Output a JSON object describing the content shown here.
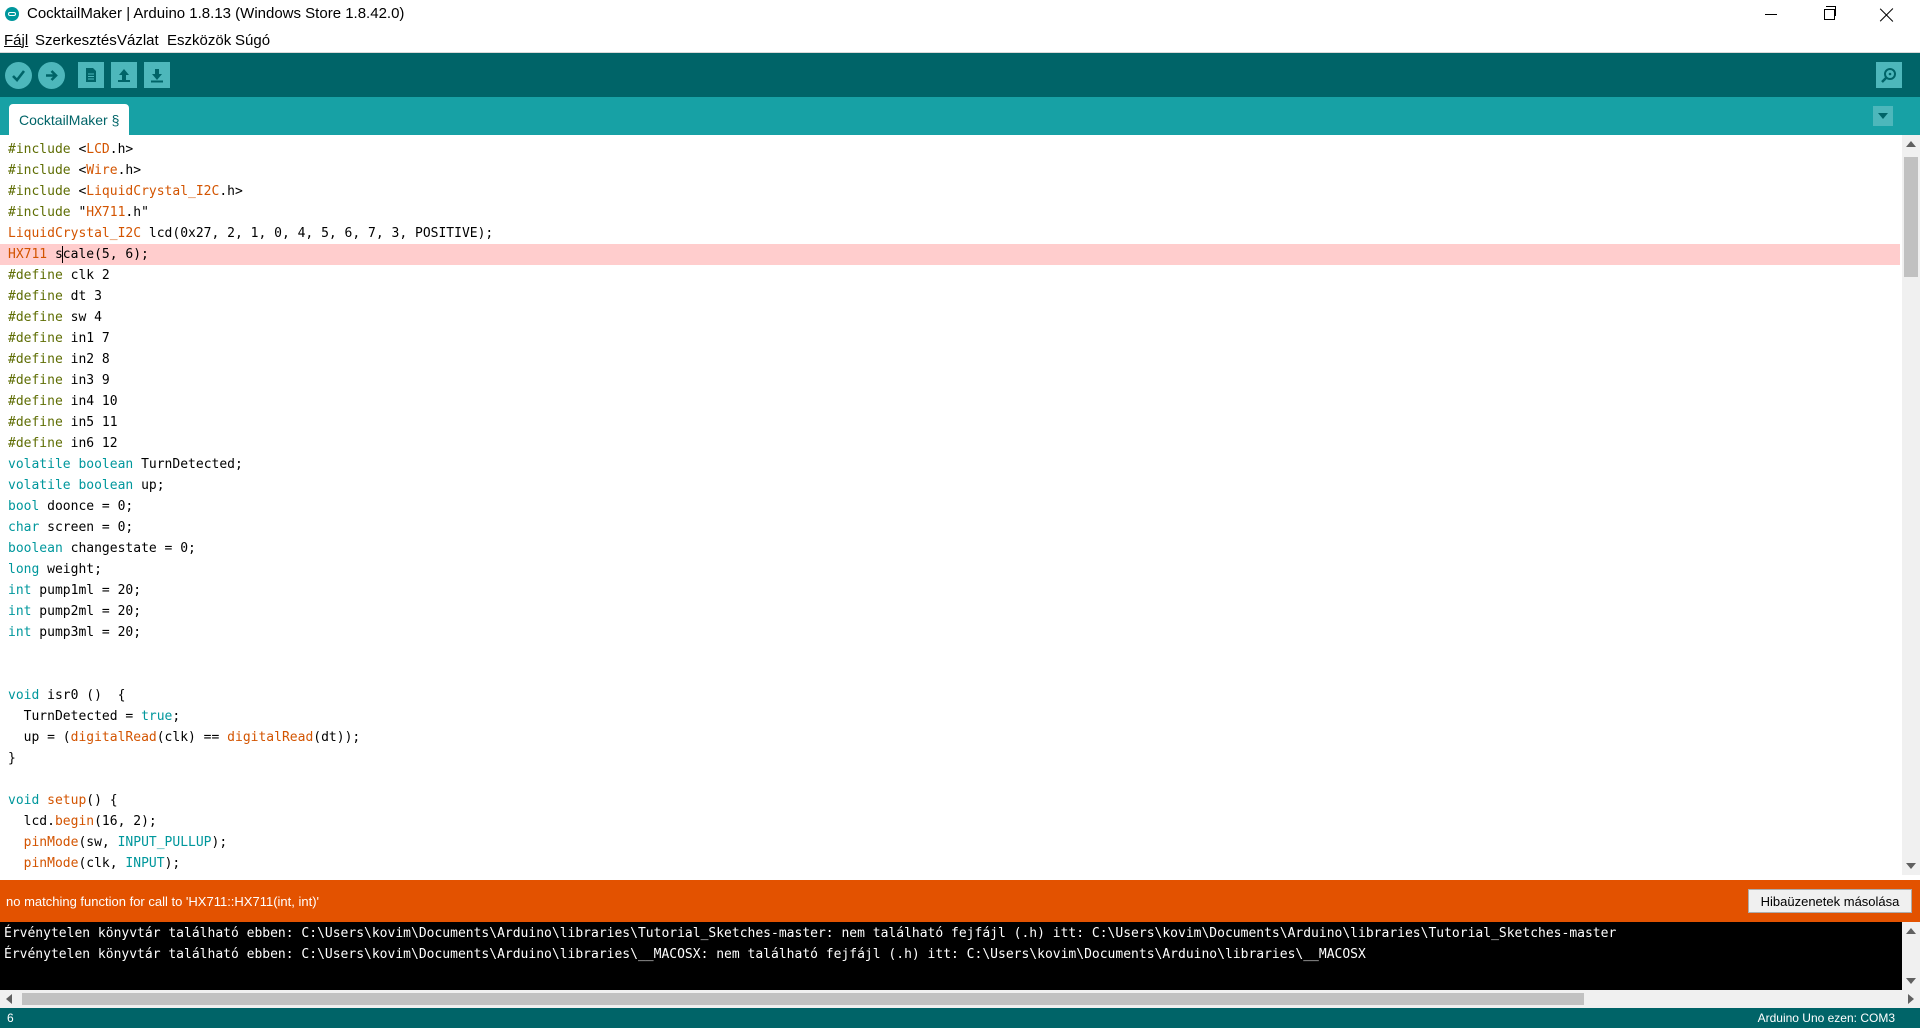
{
  "window": {
    "title": "CocktailMaker | Arduino 1.8.13 (Windows Store 1.8.42.0)"
  },
  "menu": {
    "items": [
      {
        "u": "F",
        "rest": "ájl"
      },
      {
        "u": "",
        "pre": "S",
        "ul": "z",
        "rest": "erkesztés"
      },
      {
        "u": "",
        "text": "Vázlat"
      },
      {
        "u": "",
        "text": "Eszközök"
      },
      {
        "u": "",
        "text": "Súgó"
      }
    ],
    "file": "Fájl",
    "edit": "Szerkesztés",
    "sketch": "Vázlat",
    "tools": "Eszközök",
    "help": "Súgó"
  },
  "toolbar": {
    "icons": [
      "verify-icon",
      "upload-icon",
      "new-icon",
      "open-icon",
      "save-icon",
      "serial-monitor-icon"
    ]
  },
  "tabs": [
    {
      "label": "CocktailMaker §"
    }
  ],
  "editor": {
    "highlighted_line": 6,
    "lines": [
      "#include <LCD.h>",
      "#include <Wire.h>",
      "#include <LiquidCrystal_I2C.h>",
      "#include \"HX711.h\"",
      "LiquidCrystal_I2C lcd(0x27, 2, 1, 0, 4, 5, 6, 7, 3, POSITIVE);",
      "HX711 scale(5, 6);",
      "#define clk 2",
      "#define dt 3",
      "#define sw 4",
      "#define in1 7",
      "#define in2 8",
      "#define in3 9",
      "#define in4 10",
      "#define in5 11",
      "#define in6 12",
      "volatile boolean TurnDetected;",
      "volatile boolean up;",
      "bool doonce = 0;",
      "char screen = 0;",
      "boolean changestate = 0;",
      "long weight;",
      "int pump1ml = 20;",
      "int pump2ml = 20;",
      "int pump3ml = 20;",
      "",
      "",
      "void isr0 ()  {",
      "  TurnDetected = true;",
      "  up = (digitalRead(clk) == digitalRead(dt));",
      "}",
      "",
      "void setup() {",
      "  lcd.begin(16, 2);",
      "  pinMode(sw, INPUT_PULLUP);",
      "  pinMode(clk, INPUT);"
    ]
  },
  "error": {
    "message": "no matching function for call to 'HX711::HX711(int, int)'",
    "copy_button": "Hibaüzenetek másolása"
  },
  "console": {
    "lines": [
      "Érvénytelen könyvtár található ebben: C:\\Users\\kovim\\Documents\\Arduino\\libraries\\Tutorial_Sketches-master: nem található fejfájl (.h) itt: C:\\Users\\kovim\\Documents\\Arduino\\libraries\\Tutorial_Sketches-master",
      "Érvénytelen könyvtár található ebben: C:\\Users\\kovim\\Documents\\Arduino\\libraries\\__MACOSX: nem található fejfájl (.h) itt: C:\\Users\\kovim\\Documents\\Arduino\\libraries\\__MACOSX"
    ]
  },
  "status": {
    "line_number": "6",
    "board": "Arduino Uno ezen: COM3"
  },
  "colors": {
    "toolbar": "#006468",
    "tabbar": "#17a1a5",
    "error": "#e35200",
    "highlight": "#ffcdcd"
  }
}
